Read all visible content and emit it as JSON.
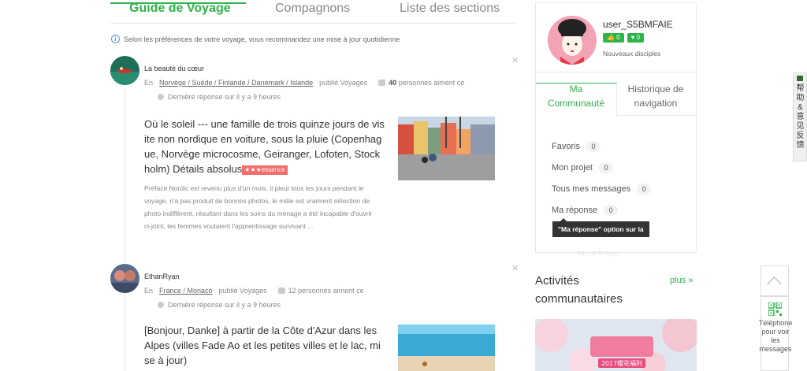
{
  "tabs": [
    {
      "label": "Guide de Voyage",
      "active": true
    },
    {
      "label": "Compagnons",
      "active": false
    },
    {
      "label": "Liste des sections",
      "active": false
    }
  ],
  "notice": "Selon les préférences de votre voyage, vous recommandez une mise à jour quotidienne",
  "posts": [
    {
      "author": "La beauté du cœur",
      "prefix": "En",
      "region": "Norvège / Suède / Finlande / Danemark / Islande",
      "published": "publié Voyages",
      "likes_count": "40",
      "likes_text": "personnes aiment ce",
      "reply": "Dernière réponse sur il y a 9 heures",
      "title": "Où le soleil --- une famille de trois quinze jours de visite non nordique en voiture, sous la pluie (Copenhague, Norvège microcosme, Geiranger, Lofoten, Stockholm) Détails absolus",
      "badge": "★★★essence",
      "excerpt": "Préface Nordic est revenu plus d'un mois, il pleut tous les jours pendant le voyage, n'a pas produit de bonnes photos, le mâle est vraiment sélection de photo indifférent, résultant dans les soins du ménage a été incapable d'ouvrir ci-joint, les femmes voulaient l'apprentissage survivant ..."
    },
    {
      "author": "EthanRyan",
      "prefix": "En",
      "region": "France / Monaco",
      "published": "publié Voyages",
      "likes_count": "12",
      "likes_text": "personnes aiment ce",
      "reply": "Dernière réponse sur il y a 9 heures",
      "title": "[Bonjour, Danke] à partir de la Côte d'Azur dans les Alpes (villes Fade Ao et les petites villes et le lac, mise à jour)"
    }
  ],
  "profile": {
    "username": "user_S5BMFAIE",
    "stat1": "0",
    "stat2": "0",
    "followers_label": "Nouveaux disciples",
    "tab_active": "Ma Communauté",
    "tab_inactive": "Historique de navigation",
    "rows": [
      {
        "label": "Favoris",
        "count": "0"
      },
      {
        "label": "Mon projet",
        "count": "0"
      },
      {
        "label": "Tous mes messages",
        "count": "0"
      },
      {
        "label": "Ma réponse",
        "count": "0"
      }
    ],
    "tooltip": "\"Ma réponse\" option sur la",
    "faded_text": "liste de la ligne!"
  },
  "activities": {
    "title": "Activités communautaires",
    "more": "plus »",
    "banner_text": "2017樱花福利"
  },
  "feedback": "帮助&意见反馈",
  "qr_label": "Téléphone pour voir les messages",
  "colors": {
    "accent": "#2eb34a",
    "badge": "#f56c6c"
  }
}
